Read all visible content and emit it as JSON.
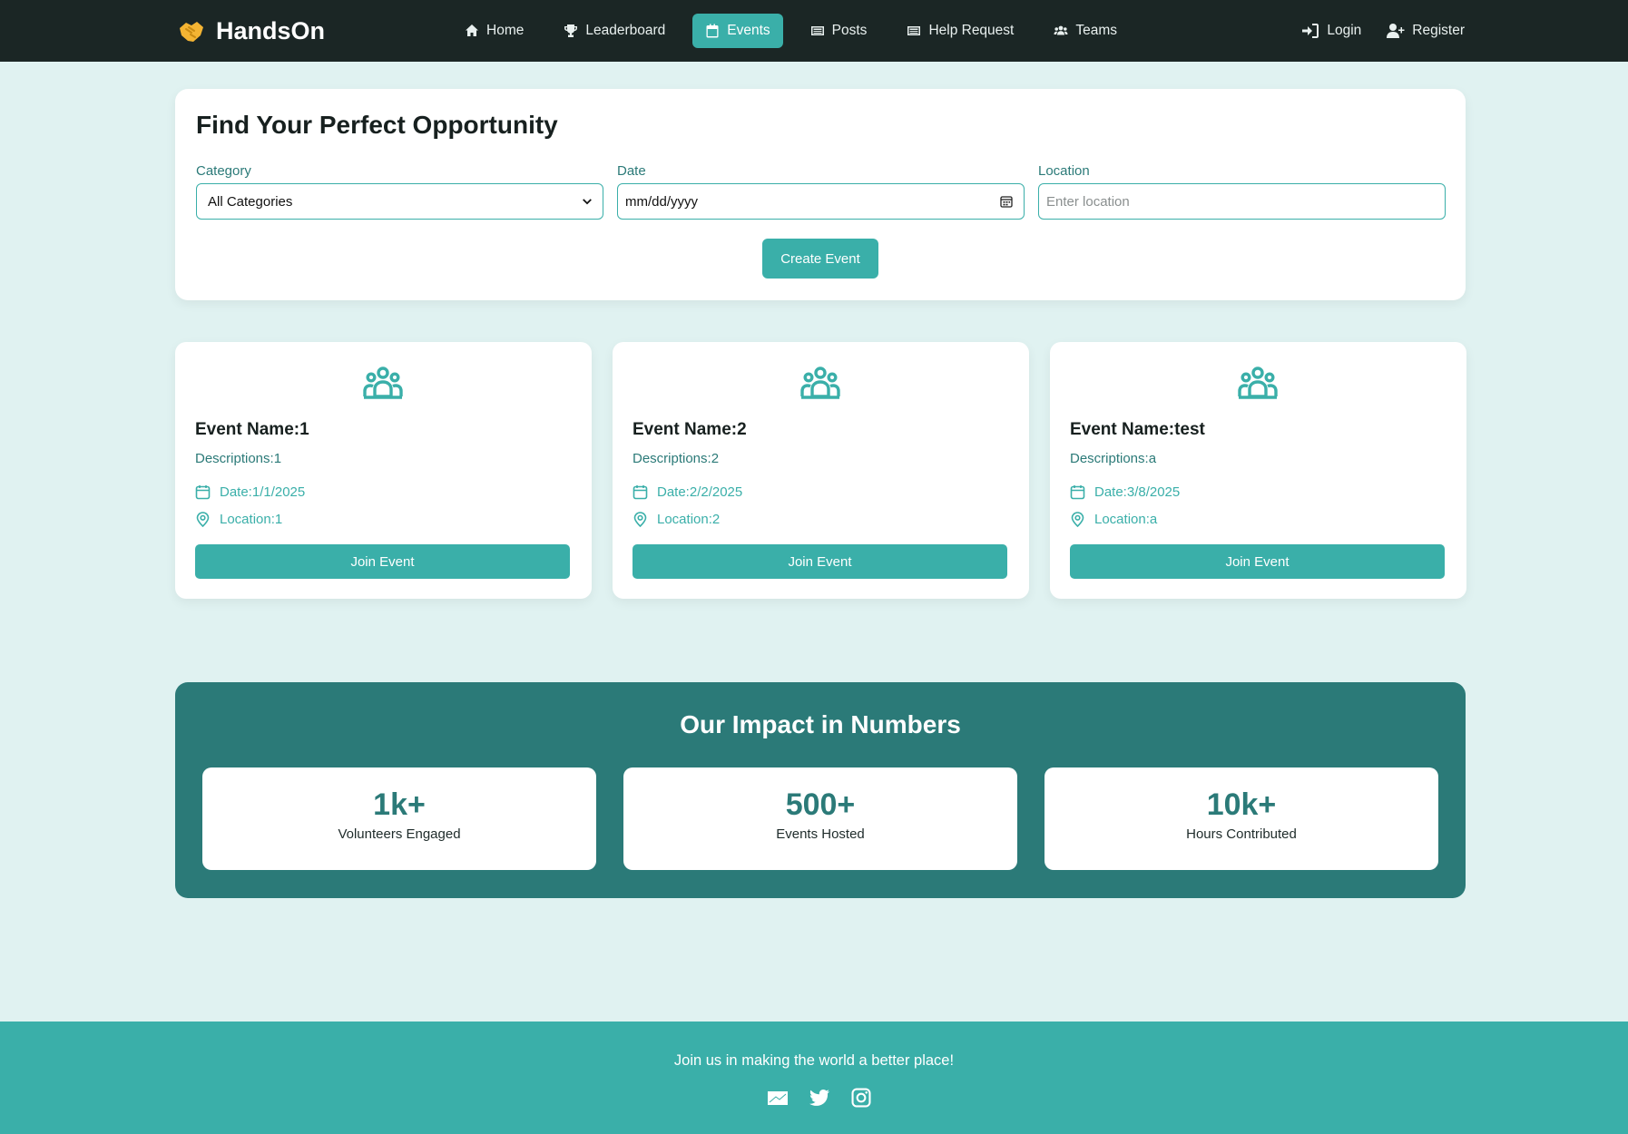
{
  "brand": {
    "name": "HandsOn"
  },
  "nav": {
    "items": [
      {
        "label": "Home",
        "icon": "home-icon"
      },
      {
        "label": "Leaderboard",
        "icon": "trophy-icon"
      },
      {
        "label": "Events",
        "icon": "calendar-icon",
        "active": true
      },
      {
        "label": "Posts",
        "icon": "newspaper-icon"
      },
      {
        "label": "Help Request",
        "icon": "newspaper-icon"
      },
      {
        "label": "Teams",
        "icon": "users-icon"
      }
    ],
    "login": "Login",
    "register": "Register"
  },
  "filters": {
    "title": "Find Your Perfect Opportunity",
    "category_label": "Category",
    "category_value": "All Categories",
    "date_label": "Date",
    "date_value": "mm/dd/yyyy",
    "location_label": "Location",
    "location_placeholder": "Enter location",
    "create_button": "Create Event"
  },
  "events": [
    {
      "name": "Event Name:1",
      "description": "Descriptions:1",
      "date": "Date:1/1/2025",
      "location": "Location:1",
      "button": "Join Event"
    },
    {
      "name": "Event Name:2",
      "description": "Descriptions:2",
      "date": "Date:2/2/2025",
      "location": "Location:2",
      "button": "Join Event"
    },
    {
      "name": "Event Name:test",
      "description": "Descriptions:a",
      "date": "Date:3/8/2025",
      "location": "Location:a",
      "button": "Join Event"
    }
  ],
  "impact": {
    "title": "Our Impact in Numbers",
    "stats": [
      {
        "value": "1k+",
        "label": "Volunteers Engaged"
      },
      {
        "value": "500+",
        "label": "Events Hosted"
      },
      {
        "value": "10k+",
        "label": "Hours Contributed"
      }
    ]
  },
  "footer": {
    "text": "Join us in making the world a better place!",
    "socials": [
      "email-icon",
      "twitter-icon",
      "instagram-icon"
    ]
  },
  "colors": {
    "nav_bg": "#1b2625",
    "accent": "#3aafa9",
    "accent_dark": "#2b7a78",
    "page_bg": "#e0f2f1",
    "logo": "#f4b433"
  }
}
